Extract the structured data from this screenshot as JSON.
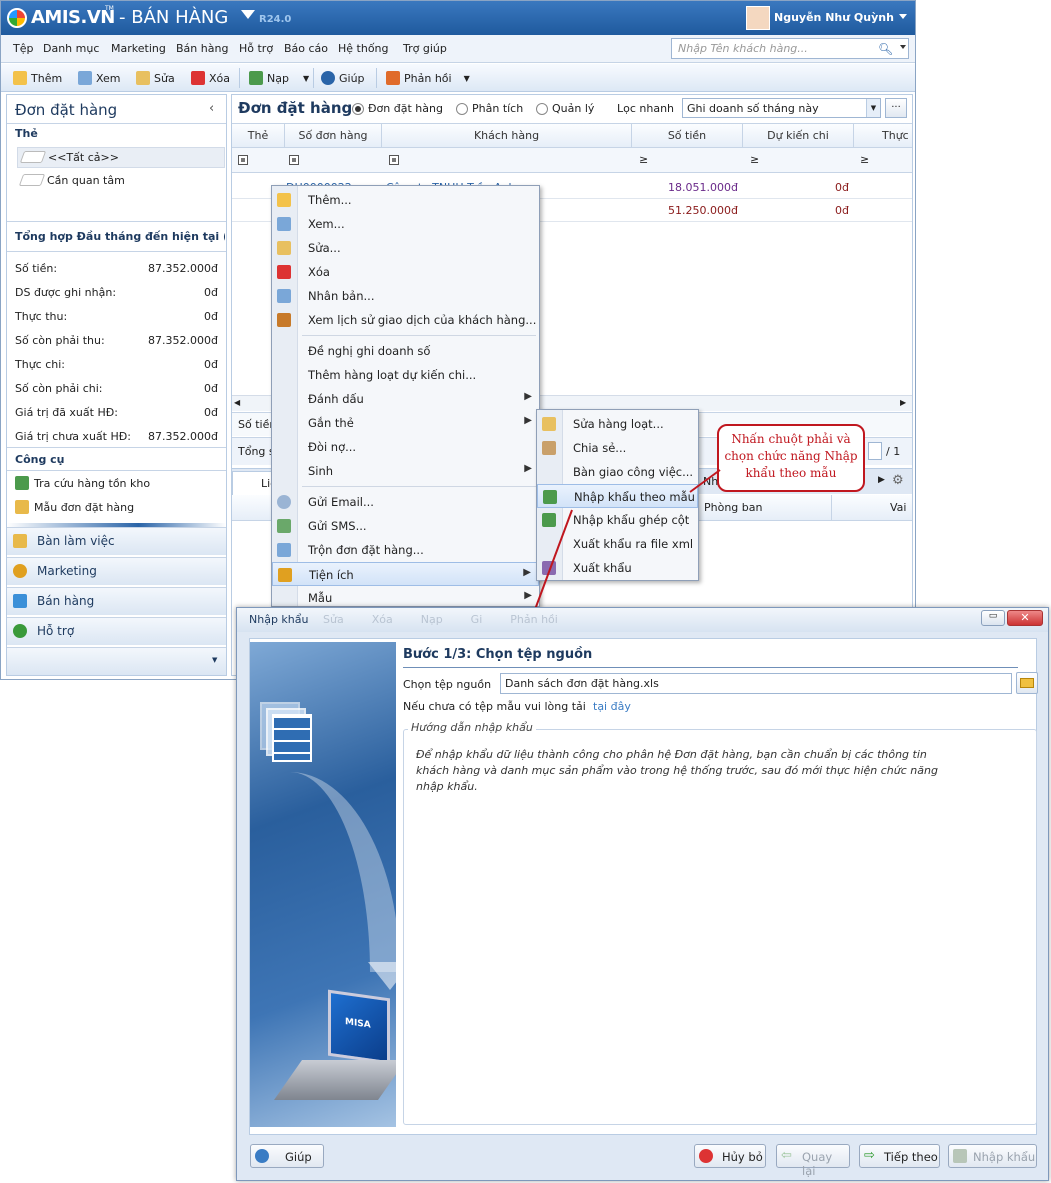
{
  "app": {
    "logo": "AMIS.VN",
    "logo_tm": "TM",
    "name": "- BÁN HÀNG",
    "version": "R24.0",
    "user": "Nguyễn Như Quỳnh"
  },
  "menu": [
    "Tệp",
    "Danh mục",
    "Marketing",
    "Bán hàng",
    "Hỗ trợ",
    "Báo cáo",
    "Hệ thống",
    "Trợ giúp"
  ],
  "search": {
    "placeholder": "Nhập Tên khách hàng..."
  },
  "toolbar": {
    "add": "Thêm",
    "view": "Xem",
    "edit": "Sửa",
    "delete": "Xóa",
    "load": "Nạp",
    "help": "Giúp",
    "feedback": "Phản hồi"
  },
  "sidebar": {
    "title": "Đơn đặt hàng",
    "tags_header": "Thẻ",
    "tags": [
      "<<Tất cả>>",
      "Cần quan tâm"
    ],
    "summary_header": "Tổng hợp Đầu tháng đến hiện tại (",
    "summary": [
      {
        "label": "Số tiền:",
        "value": "87.352.000đ"
      },
      {
        "label": "DS được ghi nhận:",
        "value": "0đ"
      },
      {
        "label": "Thực thu:",
        "value": "0đ"
      },
      {
        "label": "Số còn phải thu:",
        "value": "87.352.000đ"
      },
      {
        "label": "Thực chi:",
        "value": "0đ"
      },
      {
        "label": "Số còn phải chi:",
        "value": "0đ"
      },
      {
        "label": "Giá trị đã xuất HĐ:",
        "value": "0đ"
      },
      {
        "label": "Giá trị chưa xuất HĐ:",
        "value": "87.352.000đ"
      }
    ],
    "tools_header": "Công cụ",
    "tools": [
      "Tra cứu hàng tồn kho",
      "Mẫu đơn đặt hàng"
    ],
    "nav": [
      "Bàn làm việc",
      "Marketing",
      "Bán hàng",
      "Hỗ trợ"
    ]
  },
  "main": {
    "title": "Đơn đặt hàng",
    "views": [
      "Đơn đặt hàng",
      "Phân tích",
      "Quản lý"
    ],
    "quick_filter_label": "Lọc nhanh",
    "quick_filter_value": "Ghi doanh số tháng này",
    "columns": [
      "Thẻ",
      "Số đơn hàng",
      "Khách hàng",
      "Số tiền",
      "Dự kiến chi",
      "Thực"
    ],
    "filter_ops": [
      "≥",
      "≥",
      "≥"
    ],
    "rows": [
      {
        "order": "DH0000022",
        "customer": "Công ty TNHH Trần Anh",
        "amount": "18.051.000đ",
        "expected": "0đ"
      },
      {
        "order": "",
        "customer": "",
        "amount": "51.250.000đ",
        "expected": "0đ"
      }
    ],
    "footer_sum_label": "Số tiền",
    "footer_total_label": "Tổng s",
    "pager": "/ 1",
    "detail_tab": "Liê",
    "detail_col": "Phòng ban",
    "detail_col2": "Vai",
    "detail_trunc": "Nh"
  },
  "context_menu": {
    "items": [
      {
        "label": "Thêm...",
        "icon": "add-icon"
      },
      {
        "label": "Xem...",
        "icon": "view-icon"
      },
      {
        "label": "Sửa...",
        "icon": "edit-icon"
      },
      {
        "label": "Xóa",
        "icon": "delete-icon"
      },
      {
        "label": "Nhân bản...",
        "icon": "duplicate-icon"
      },
      {
        "label": "Xem lịch sử giao dịch của khách hàng...",
        "icon": "history-icon"
      },
      {
        "label": "Đề nghị ghi doanh số",
        "icon": ""
      },
      {
        "label": "Thêm hàng loạt dự kiến chi...",
        "icon": ""
      },
      {
        "label": "Đánh dấu",
        "icon": "",
        "submenu": true
      },
      {
        "label": "Gắn thẻ",
        "icon": "",
        "submenu": true
      },
      {
        "label": "Đòi nợ...",
        "icon": ""
      },
      {
        "label": "Sinh",
        "icon": "",
        "submenu": true
      },
      {
        "label": "Gửi Email...",
        "icon": "email-icon"
      },
      {
        "label": "Gửi SMS...",
        "icon": "sms-icon"
      },
      {
        "label": "Trộn đơn đặt hàng...",
        "icon": "merge-icon"
      },
      {
        "label": "Tiện ích",
        "icon": "utility-icon",
        "submenu": true
      },
      {
        "label": "Mẫu",
        "icon": "",
        "submenu": true
      }
    ]
  },
  "submenu": {
    "items": [
      "Sửa hàng loạt...",
      "Chia sẻ...",
      "Bàn giao công việc...",
      "Nhập khẩu theo mẫu",
      "Nhập khẩu ghép cột",
      "Xuất khẩu ra file xml",
      "Xuất khẩu"
    ]
  },
  "callout": "Nhấn chuột phải và chọn chức năng Nhập khẩu theo mẫu",
  "dialog": {
    "title": "Nhập khẩu",
    "ghost_toolbar": [
      "Sửa",
      "Xóa",
      "Nạp",
      "Gi",
      "Phản hồi"
    ],
    "step_title": "Bước 1/3: Chọn tệp nguồn",
    "file_label": "Chọn tệp nguồn",
    "file_value": "Danh sách đơn đặt hàng.xls",
    "template_text": "Nếu chưa có tệp mẫu vui lòng tải",
    "template_link": "tại đây",
    "guide_legend": "Hướng dẫn nhập khẩu",
    "guide_text": "Để nhập khẩu dữ liệu thành công cho phân hệ Đơn đặt hàng, bạn cần chuẩn bị các thông tin khách hàng và danh mục sản phẩm vào trong hệ thống trước, sau đó mới thực hiện chức năng nhập khẩu.",
    "laptop_brand": "MISA",
    "buttons": {
      "help": "Giúp",
      "cancel": "Hủy bỏ",
      "back": "Quay lại",
      "next": "Tiếp theo",
      "import": "Nhập khẩu"
    }
  },
  "colors": {
    "accent": "#1f5a9e",
    "callout": "#c0171f",
    "amount": "#8a1a1a"
  }
}
